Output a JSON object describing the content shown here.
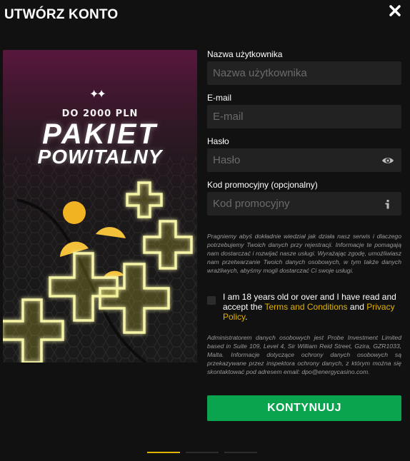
{
  "header": {
    "title": "UTWÓRZ KONTO",
    "close_icon": "close-icon"
  },
  "banner": {
    "stars_icon": "sparkle-stars-icon",
    "amount": "DO 2000 PLN",
    "headline_line1": "PAKIET",
    "headline_line2": "POWITALNY"
  },
  "form": {
    "username": {
      "label": "Nazwa użytkownika",
      "placeholder": "Nazwa użytkownika",
      "value": ""
    },
    "email": {
      "label": "E-mail",
      "placeholder": "E-mail",
      "value": ""
    },
    "password": {
      "label": "Hasło",
      "placeholder": "Hasło",
      "value": "",
      "suffix_icon": "eye-icon"
    },
    "promo": {
      "label": "Kod promocyjny (opcjonalny)",
      "placeholder": "Kod promocyjny",
      "value": "",
      "suffix_icon": "info-icon"
    }
  },
  "info_text": "Pragniemy abyś dokładnie wiedział jak działa nasz serwis i dlaczego potrzebujemy Twoich danych przy rejestracji. Informacje te pomagają nam dostarczać i rozwijać nasze usługi. Wyrażając zgodę, umożliwiasz nam przetwarzanie Twoich danych osobowych, w tym także danych wrażliwych, abyśmy mogli dostarczać Ci swoje usługi.",
  "consent": {
    "checked": false,
    "text_before": "I am 18 years old or over and I have read and accept the ",
    "terms_link": "Terms and Conditions",
    "text_and": " and ",
    "privacy_link": "Privacy Policy",
    "text_end": "."
  },
  "admin_text": "Administratorem danych osobowych jest Probe Investment Limited based in Suite 109, Level 4, Sir William Reid Street, Gzira, GZR1033, Malta. Informacje dotyczące ochrony danych osobowych są przekazywane przez inspektora ochrony danych, z którym można się skontaktować pod adresem email: dpo@energycasino.com.",
  "submit_label": "KONTYNUUJ",
  "steps": {
    "count": 3,
    "active": 1
  },
  "colors": {
    "background": "#111111",
    "input_background": "#222222",
    "accent_link": "#e2b300",
    "button": "#0aa34e",
    "step_active": "#e2b300",
    "step_inactive": "#2c2c2c"
  }
}
